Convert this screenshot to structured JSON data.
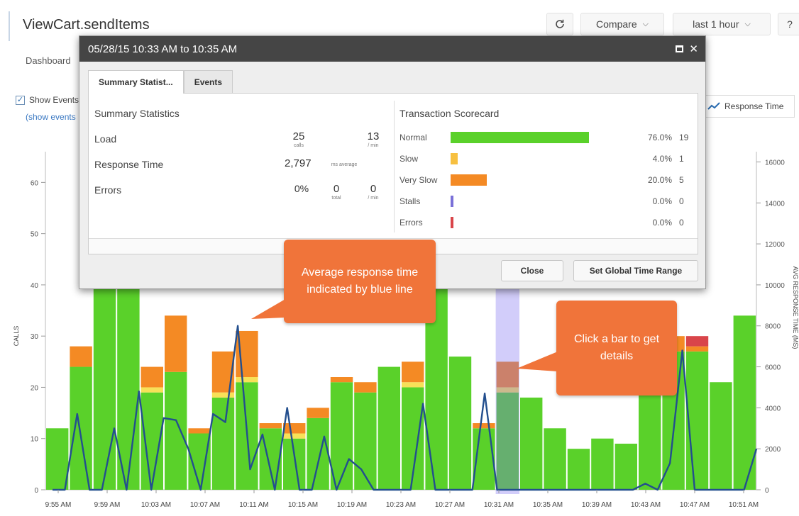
{
  "header": {
    "title": "ViewCart.sendItems",
    "compare_label": "Compare",
    "range_label": "last 1 hour",
    "help_label": "?",
    "refresh_icon": "refresh-icon"
  },
  "breadcrumb": {
    "label": "Dashboard"
  },
  "events_toggle": {
    "label": "Show Events",
    "link": "(show events"
  },
  "legend": {
    "label": "Response Time"
  },
  "modal": {
    "title": "05/28/15 10:33 AM to 10:35 AM",
    "tabs": [
      "Summary Statist...",
      "Events"
    ],
    "summary": {
      "title": "Summary Statistics",
      "load_label": "Load",
      "load_calls": "25",
      "load_calls_unit": "calls",
      "load_rate": "13",
      "load_rate_unit": "/ min",
      "rt_label": "Response Time",
      "rt_value": "2,797",
      "rt_unit": "ms average",
      "errors_label": "Errors",
      "errors_pct": "0%",
      "errors_total": "0",
      "errors_total_unit": "total",
      "errors_rate": "0",
      "errors_rate_unit": "/ min"
    },
    "scorecard": {
      "title": "Transaction Scorecard",
      "rows": [
        {
          "label": "Normal",
          "pct": "76.0%",
          "count": "19",
          "fraction": 0.76,
          "color": "#5ad12a"
        },
        {
          "label": "Slow",
          "pct": "4.0%",
          "count": "1",
          "fraction": 0.04,
          "color": "#f7c040"
        },
        {
          "label": "Very Slow",
          "pct": "20.0%",
          "count": "5",
          "fraction": 0.2,
          "color": "#f48a24"
        },
        {
          "label": "Stalls",
          "pct": "0.0%",
          "count": "0",
          "fraction": 0,
          "color": "#7a70d8"
        },
        {
          "label": "Errors",
          "pct": "0.0%",
          "count": "0",
          "fraction": 0,
          "color": "#d9454a"
        }
      ]
    },
    "close_label": "Close",
    "global_label": "Set Global Time Range"
  },
  "callouts": {
    "response": "Average response time indicated by blue line",
    "bar": "Click a bar to get details"
  },
  "chart_data": {
    "type": "bar",
    "ylabel": "CALLS",
    "y2label": "AVG RESPONSE TIME (MS)",
    "ylim": [
      0,
      66
    ],
    "y2lim": [
      0,
      16500
    ],
    "yticks": [
      0,
      10,
      20,
      30,
      40,
      50,
      60
    ],
    "y2ticks": [
      0,
      2000,
      4000,
      6000,
      8000,
      10000,
      12000,
      14000,
      16000
    ],
    "xtick_labels": [
      "9:55 AM",
      "9:59 AM",
      "10:03 AM",
      "10:07 AM",
      "10:11 AM",
      "10:15 AM",
      "10:19 AM",
      "10:23 AM",
      "10:27 AM",
      "10:31 AM",
      "10:35 AM",
      "10:39 AM",
      "10:43 AM",
      "10:47 AM",
      "10:51 AM"
    ],
    "bars": [
      {
        "normal": 12,
        "slow": 0,
        "very_slow": 0,
        "errors": 0
      },
      {
        "normal": 24,
        "slow": 0,
        "very_slow": 4,
        "errors": 0
      },
      {
        "normal": 41,
        "slow": 0,
        "very_slow": 0,
        "errors": 0
      },
      {
        "normal": 41,
        "slow": 0,
        "very_slow": 0,
        "errors": 0
      },
      {
        "normal": 19,
        "slow": 1,
        "very_slow": 4,
        "errors": 0
      },
      {
        "normal": 23,
        "slow": 0,
        "very_slow": 11,
        "errors": 0
      },
      {
        "normal": 11,
        "slow": 0,
        "very_slow": 1,
        "errors": 0
      },
      {
        "normal": 18,
        "slow": 1,
        "very_slow": 8,
        "errors": 0
      },
      {
        "normal": 21,
        "slow": 1,
        "very_slow": 9,
        "errors": 0
      },
      {
        "normal": 12,
        "slow": 0,
        "very_slow": 1,
        "errors": 0
      },
      {
        "normal": 10,
        "slow": 1,
        "very_slow": 2,
        "errors": 0
      },
      {
        "normal": 14,
        "slow": 0,
        "very_slow": 2,
        "errors": 0
      },
      {
        "normal": 21,
        "slow": 0,
        "very_slow": 1,
        "errors": 0
      },
      {
        "normal": 19,
        "slow": 0,
        "very_slow": 2,
        "errors": 0
      },
      {
        "normal": 24,
        "slow": 0,
        "very_slow": 0,
        "errors": 0
      },
      {
        "normal": 20,
        "slow": 1,
        "very_slow": 4,
        "errors": 0
      },
      {
        "normal": 41,
        "slow": 0,
        "very_slow": 0,
        "errors": 0
      },
      {
        "normal": 26,
        "slow": 0,
        "very_slow": 0,
        "errors": 0
      },
      {
        "normal": 12,
        "slow": 0,
        "very_slow": 1,
        "errors": 0
      },
      {
        "normal": 19,
        "slow": 1,
        "very_slow": 5,
        "errors": 0
      },
      {
        "normal": 18,
        "slow": 0,
        "very_slow": 0,
        "errors": 0
      },
      {
        "normal": 12,
        "slow": 0,
        "very_slow": 0,
        "errors": 0
      },
      {
        "normal": 8,
        "slow": 0,
        "very_slow": 0,
        "errors": 0
      },
      {
        "normal": 10,
        "slow": 0,
        "very_slow": 0,
        "errors": 0
      },
      {
        "normal": 9,
        "slow": 0,
        "very_slow": 0,
        "errors": 0
      },
      {
        "normal": 20,
        "slow": 0,
        "very_slow": 0,
        "errors": 0
      },
      {
        "normal": 27,
        "slow": 0,
        "very_slow": 3,
        "errors": 0
      },
      {
        "normal": 27,
        "slow": 0,
        "very_slow": 1,
        "errors": 2
      },
      {
        "normal": 21,
        "slow": 0,
        "very_slow": 0,
        "errors": 0
      },
      {
        "normal": 34,
        "slow": 0,
        "very_slow": 0,
        "errors": 0
      }
    ],
    "selected_bar": 19,
    "response_time": [
      0,
      0,
      3700,
      0,
      0,
      3000,
      0,
      4800,
      0,
      3500,
      3400,
      2000,
      0,
      3700,
      3300,
      8000,
      1000,
      2700,
      0,
      4000,
      0,
      0,
      2600,
      0,
      1500,
      1000,
      0,
      0,
      0,
      0,
      4200,
      0,
      0,
      0,
      0,
      4700,
      0,
      0,
      0,
      0,
      0,
      0,
      0,
      0,
      0,
      0,
      0,
      0,
      300,
      0,
      1300,
      6800,
      0,
      0,
      0,
      0,
      0,
      2000
    ]
  }
}
